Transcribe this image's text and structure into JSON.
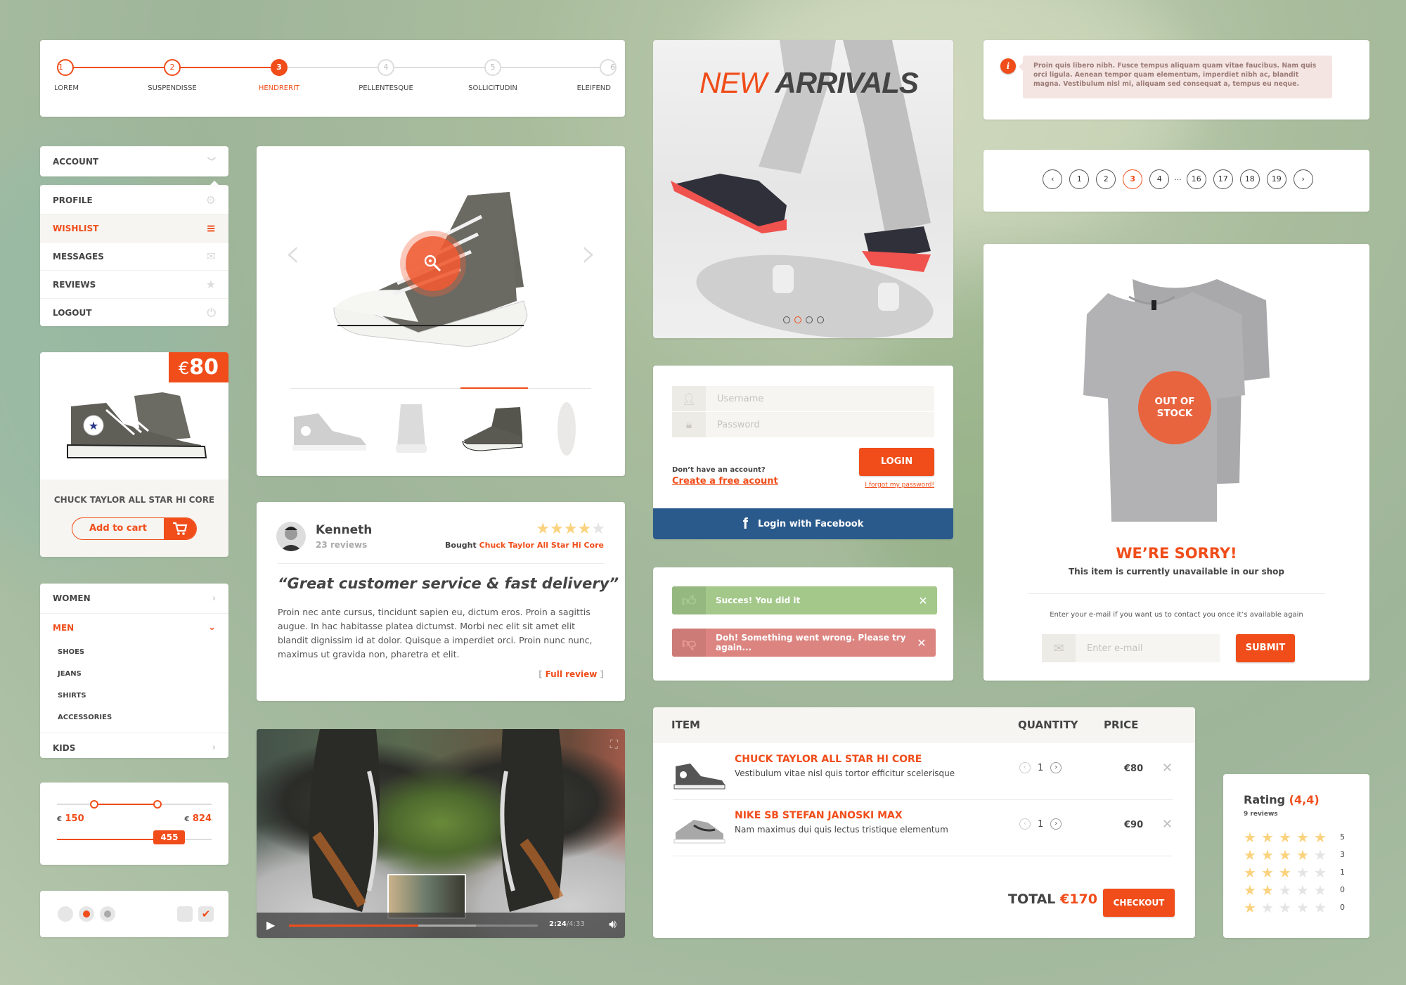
{
  "colors": {
    "accent": "#f04d1a",
    "facebook": "#2a5a8c",
    "success": "#a3c88a",
    "error": "#dc8480",
    "star": "#fbd27e"
  },
  "stepper": {
    "steps": [
      {
        "num": "1",
        "label": "LOREM",
        "state": "done"
      },
      {
        "num": "2",
        "label": "SUSPENDISSE",
        "state": "done"
      },
      {
        "num": "3",
        "label": "HENDRERIT",
        "state": "active"
      },
      {
        "num": "4",
        "label": "PELLENTESQUE",
        "state": "todo"
      },
      {
        "num": "5",
        "label": "SOLLICITUDIN",
        "state": "todo"
      },
      {
        "num": "6",
        "label": "ELEIFEND",
        "state": "todo"
      }
    ]
  },
  "account_menu": {
    "header": "ACCOUNT",
    "items": [
      {
        "label": "PROFILE",
        "icon": "gear-icon"
      },
      {
        "label": "WISHLIST",
        "icon": "list-icon",
        "active": true
      },
      {
        "label": "MESSAGES",
        "icon": "envelope-icon"
      },
      {
        "label": "REVIEWS",
        "icon": "star-icon"
      },
      {
        "label": "LOGOUT",
        "icon": "power-icon"
      }
    ]
  },
  "product_card": {
    "currency": "€",
    "price": "80",
    "name": "CHUCK TAYLOR ALL STAR HI CORE",
    "add_to_cart": "Add to cart"
  },
  "categories": {
    "items": [
      {
        "label": "WOMEN"
      },
      {
        "label": "MEN",
        "open": true,
        "children": [
          "SHOES",
          "JEANS",
          "SHIRTS",
          "ACCESSORIES"
        ]
      },
      {
        "label": "KIDS"
      }
    ]
  },
  "range_slider": {
    "currency": "€",
    "min_value": "150",
    "max_value": "824",
    "min_fraction": 0.24,
    "max_fraction": 0.65
  },
  "single_slider": {
    "value": "455",
    "fraction": 0.72
  },
  "controls": {
    "radios": [
      "unchecked",
      "checked",
      "disabled"
    ],
    "checkboxes": [
      "unchecked",
      "checked"
    ]
  },
  "gallery": {
    "zoom_icon": "zoom-in-icon",
    "prev": "‹",
    "next": "›",
    "thumbnails": [
      "side-view",
      "back-view",
      "angle-view",
      "sole-view"
    ],
    "active_thumb": 2
  },
  "review": {
    "name": "Kenneth",
    "reviews": "23 reviews",
    "rating": 4,
    "max_rating": 5,
    "bought_label": "Bought",
    "bought_product": "Chuck Taylor All Star Hi Core",
    "title": "“Great customer service & fast delivery”",
    "body": "Proin nec ante cursus, tincidunt sapien eu, dictum eros. Proin a sagittis augue. In hac habitasse platea dictumst. Morbi nec elit sit amet elit blandit dignissim id at dolor. Quisque a imperdiet orci. Proin nunc nunc, maximus ut gravida non, pharetra et elit.",
    "full_review": "Full review"
  },
  "video": {
    "current_time": "2:24",
    "total_time": "4:33",
    "progress": 0.52,
    "buffered": 0.75
  },
  "banner": {
    "word1": "NEW",
    "word2": "ARRIVALS",
    "slides": 4,
    "active_slide": 1
  },
  "login": {
    "username_placeholder": "Username",
    "password_placeholder": "Password",
    "login_button": "LOGIN",
    "no_account": "Don’t have an account?",
    "create_account": "Create a free acount",
    "forgot": "I forgot my password!",
    "facebook": "Login with Facebook"
  },
  "alerts": {
    "success": "Succes! You did it",
    "error": "Doh! Something went wrong. Please try again..."
  },
  "cart": {
    "headers": {
      "item": "ITEM",
      "quantity": "QUANTITY",
      "price": "PRICE"
    },
    "rows": [
      {
        "name": "CHUCK TAYLOR ALL STAR HI CORE",
        "desc": "Vestibulum vitae nisl quis tortor efficitur scelerisque",
        "qty": "1",
        "price": "€80"
      },
      {
        "name": "NIKE SB STEFAN JANOSKI MAX",
        "desc": "Nam maximus dui quis lectus tristique elementum",
        "qty": "1",
        "price": "€90"
      }
    ],
    "total_label": "TOTAL",
    "total_value": "€170",
    "checkout": "CHECKOUT"
  },
  "info_alert": {
    "icon": "i",
    "text": "Proin quis libero nibh. Fusce tempus aliquam quam vitae faucibus. Nam quis orci ligula. Aenean tempor quam elementum, imperdiet nibh ac, blandit magna. Vestibulum nisl mi, aliquam sed consequat a, tempus eu neque."
  },
  "pagination": {
    "prev": "‹",
    "pages": [
      "1",
      "2",
      "3",
      "4",
      "...",
      "16",
      "17",
      "18",
      "19"
    ],
    "active": "3",
    "next": "›"
  },
  "out_of_stock": {
    "badge_line1": "OUT OF",
    "badge_line2": "STOCK",
    "title": "WE’RE SORRY!",
    "subtitle": "This item is currently unavailable in our shop",
    "prompt": "Enter your e-mail if you want us to contact you once it’s available again",
    "email_placeholder": "Enter e-mail",
    "submit": "SUBMIT"
  },
  "rating": {
    "label": "Rating",
    "value": "(4,4)",
    "reviews": "9 reviews",
    "rows": [
      {
        "stars": 5,
        "count": "5"
      },
      {
        "stars": 4,
        "count": "3"
      },
      {
        "stars": 3,
        "count": "1"
      },
      {
        "stars": 2,
        "count": "0"
      },
      {
        "stars": 1,
        "count": "0"
      }
    ]
  }
}
